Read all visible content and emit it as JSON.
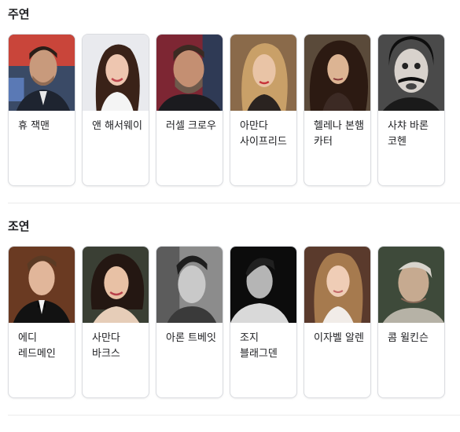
{
  "sections": [
    {
      "title": "주연",
      "people": [
        {
          "name": "휴 잭맨",
          "icon": "person-photo"
        },
        {
          "name": "앤 해서웨이",
          "icon": "person-photo"
        },
        {
          "name": "러셀 크로우",
          "icon": "person-photo"
        },
        {
          "name": "아만다 사이프리드",
          "icon": "person-photo"
        },
        {
          "name": "헬레나 본햄 카터",
          "icon": "person-photo"
        },
        {
          "name": "사챠 바론 코헨",
          "icon": "person-photo"
        }
      ]
    },
    {
      "title": "조연",
      "people": [
        {
          "name": "에디 레드메인",
          "icon": "person-photo"
        },
        {
          "name": "사만다 바크스",
          "icon": "person-photo"
        },
        {
          "name": "아론 트베잇",
          "icon": "person-photo"
        },
        {
          "name": "조지 블래그덴",
          "icon": "person-photo"
        },
        {
          "name": "이자벨 알렌",
          "icon": "person-photo"
        },
        {
          "name": "콤 윌킨슨",
          "icon": "person-photo"
        }
      ]
    }
  ]
}
